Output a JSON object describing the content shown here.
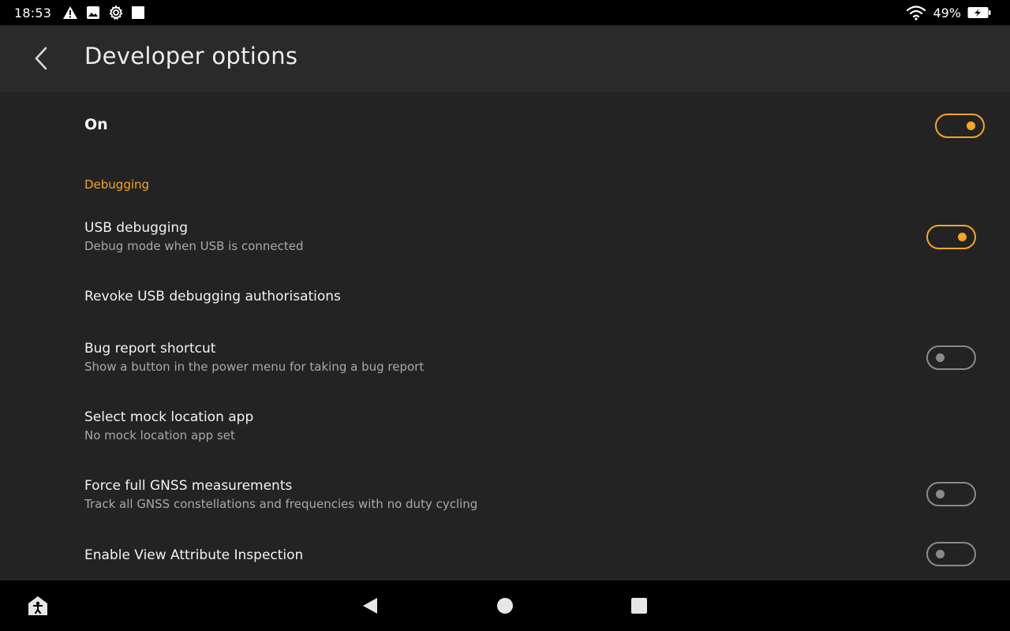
{
  "status_bar": {
    "time": "18:53",
    "battery_percent": "49%",
    "icons": [
      "warning-icon",
      "image-icon",
      "settings-gear-icon",
      "square-notification-icon",
      "wifi-icon",
      "battery-charging-icon"
    ]
  },
  "app_bar": {
    "title": "Developer options",
    "back_icon": "chevron-left-icon"
  },
  "master_switch": {
    "label": "On",
    "checked": true
  },
  "sections": [
    {
      "header": "Debugging",
      "items": [
        {
          "title": "USB debugging",
          "summary": "Debug mode when USB is connected",
          "toggle": true,
          "checked": true
        },
        {
          "title": "Revoke USB debugging authorisations",
          "summary": "",
          "toggle": false
        },
        {
          "title": "Bug report shortcut",
          "summary": "Show a button in the power menu for taking a bug report",
          "toggle": true,
          "checked": false
        },
        {
          "title": "Select mock location app",
          "summary": "No mock location app set",
          "toggle": false
        },
        {
          "title": "Force full GNSS measurements",
          "summary": "Track all GNSS constellations and frequencies with no duty cycling",
          "toggle": true,
          "checked": false
        },
        {
          "title": "Enable View Attribute Inspection",
          "summary": "",
          "toggle": true,
          "checked": false
        }
      ]
    }
  ],
  "nav_bar": {
    "left_icon": "accessibility-home-icon",
    "buttons": [
      "back-triangle-icon",
      "home-circle-icon",
      "recents-square-icon"
    ]
  },
  "colors": {
    "accent": "#f5a623",
    "background": "#232323",
    "app_bar": "#2a2a2a",
    "switch_off": "#8a8a8a"
  }
}
